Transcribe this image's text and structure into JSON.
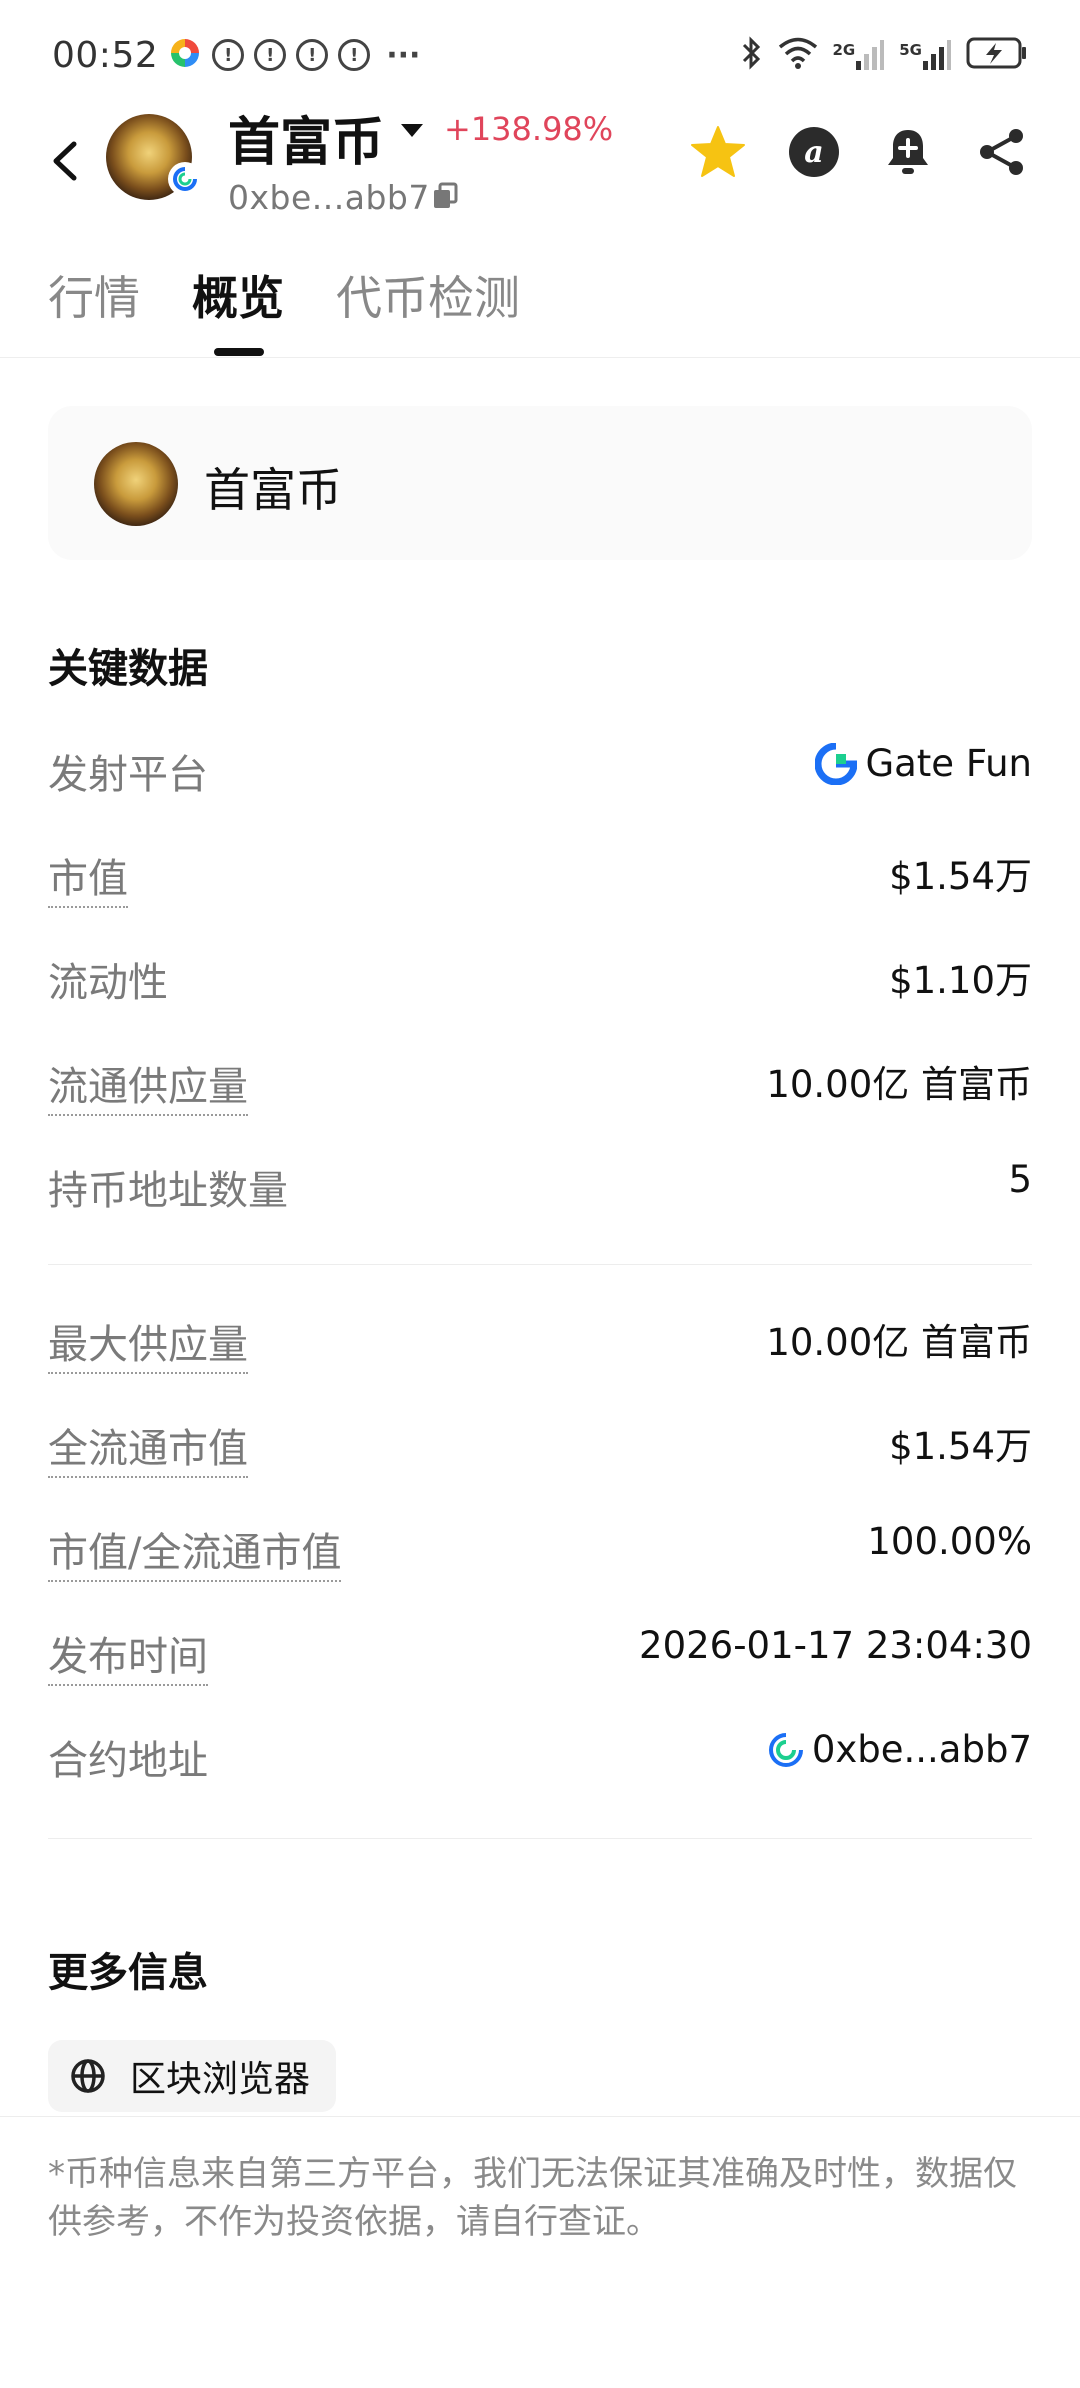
{
  "status_bar": {
    "time": "00:52",
    "more": "···",
    "net_2g": "2G",
    "net_5g": "5G"
  },
  "header": {
    "title": "首富币",
    "change": "+138.98%",
    "address": "0xbe...abb7",
    "change_color": "#e0455b",
    "star_color": "#f6c312"
  },
  "tabs": [
    {
      "label": "行情"
    },
    {
      "label": "概览"
    },
    {
      "label": "代币检测"
    }
  ],
  "name_card": {
    "name": "首富币"
  },
  "key_data": {
    "title": "关键数据",
    "rows": [
      {
        "label": "发射平台",
        "value": "Gate Fun"
      },
      {
        "label": "市值",
        "value": "$1.54万"
      },
      {
        "label": "流动性",
        "value": "$1.10万"
      },
      {
        "label": "流通供应量",
        "value": "10.00亿 首富币"
      },
      {
        "label": "持币地址数量",
        "value": "5"
      },
      {
        "label": "最大供应量",
        "value": "10.00亿 首富币"
      },
      {
        "label": "全流通市值",
        "value": "$1.54万"
      },
      {
        "label": "市值/全流通市值",
        "value": "100.00%"
      },
      {
        "label": "发布时间",
        "value": "2026-01-17 23:04:30"
      },
      {
        "label": "合约地址",
        "value": "0xbe...abb7"
      }
    ]
  },
  "more_info": {
    "title": "更多信息",
    "explorer_label": "区块浏览器"
  },
  "disclaimer": "*币种信息来自第三方平台，我们无法保证其准确及时性，数据仅供参考，不作为投资依据，请自行查证。",
  "icons": {
    "back": "chevron-left-icon",
    "star": "star-icon",
    "ai": "ai-assistant-icon",
    "bell": "bell-add-icon",
    "share": "share-icon",
    "copy": "copy-icon",
    "globe": "globe-icon",
    "gate": "gate-logo-icon"
  }
}
